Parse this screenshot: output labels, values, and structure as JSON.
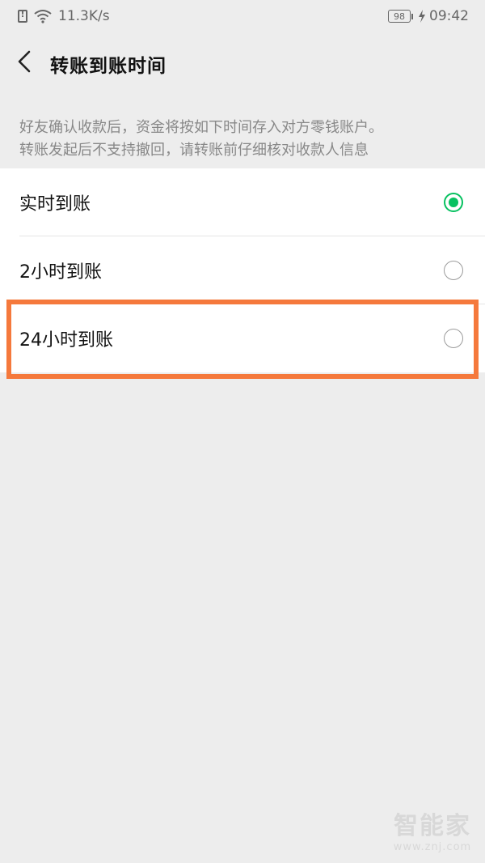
{
  "status_bar": {
    "network_speed": "11.3K/s",
    "battery_level": "98",
    "time": "09:42",
    "icons": [
      "sim-alert-icon",
      "wifi-icon",
      "battery-icon",
      "charging-icon"
    ]
  },
  "header": {
    "back_icon": "chevron-left-icon",
    "title": "转账到账时间"
  },
  "notice": {
    "line1": "好友确认收款后，资金将按如下时间存入对方零钱账户。",
    "line2": "转账发起后不支持撤回，请转账前仔细核对收款人信息"
  },
  "options": [
    {
      "label": "实时到账",
      "selected": true
    },
    {
      "label": "2小时到账",
      "selected": false
    },
    {
      "label": "24小时到账",
      "selected": false
    }
  ],
  "colors": {
    "accent": "#07c160",
    "highlight": "#f5793c",
    "background": "#ededed"
  },
  "watermark": {
    "main": "智能家",
    "sub": "www.znj.com"
  }
}
